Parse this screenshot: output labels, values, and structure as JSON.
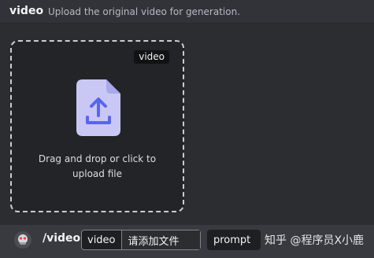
{
  "header": {
    "option_name": "video",
    "description": "Upload the original video for generation."
  },
  "dropzone": {
    "tag": "video",
    "line1": "Drag and drop or click to",
    "line2": "upload file",
    "icon": "file-upload-icon"
  },
  "command": {
    "avatar_icon": "bot-avatar",
    "name": "/video",
    "options": [
      {
        "key": "video",
        "value": "请添加文件"
      },
      {
        "key": "prompt"
      }
    ]
  },
  "watermark": "知乎 @程序员X小鹿",
  "colors": {
    "background": "#2b2d31",
    "dropzone_bg": "#232428",
    "file_icon": "#c9c8f5",
    "upload_arrow": "#5865f2"
  }
}
